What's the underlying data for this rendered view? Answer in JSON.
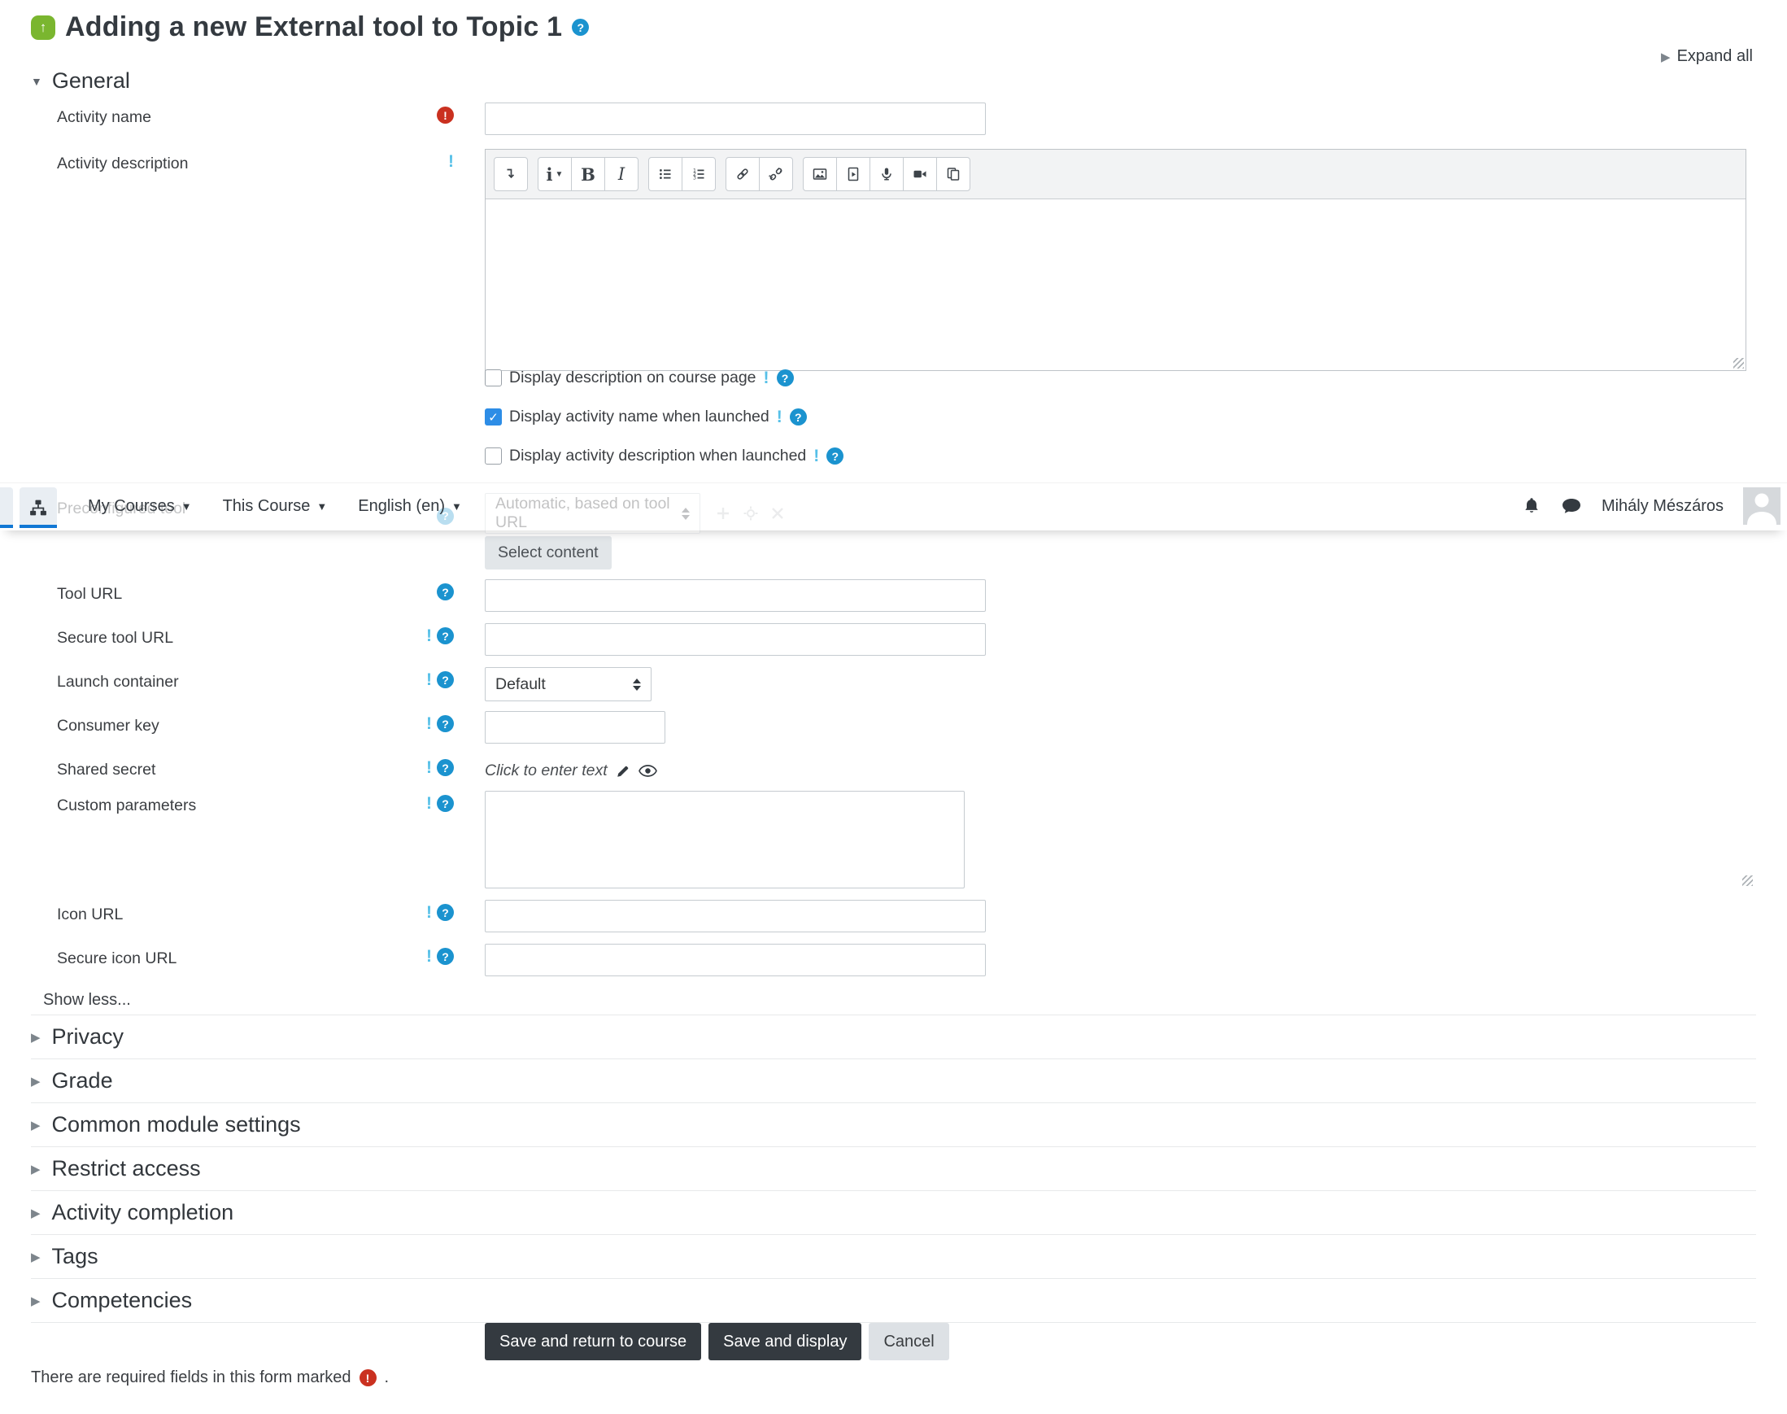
{
  "page": {
    "title": "Adding a new External tool to Topic 1",
    "expand_all": "Expand all",
    "required_note": "There are required fields in this form marked",
    "required_note_suffix": "."
  },
  "navbar": {
    "items": [
      {
        "label": "My Courses"
      },
      {
        "label": "This Course"
      },
      {
        "label": "English (en)"
      }
    ],
    "user_name": "Mihály Mészáros"
  },
  "sections": {
    "general": "General",
    "collapsed": [
      "Privacy",
      "Grade",
      "Common module settings",
      "Restrict access",
      "Activity completion",
      "Tags",
      "Competencies"
    ]
  },
  "form": {
    "activity_name": {
      "label": "Activity name",
      "value": ""
    },
    "activity_description": {
      "label": "Activity description",
      "value": ""
    },
    "checkboxes": [
      {
        "label": "Display description on course page",
        "checked": false
      },
      {
        "label": "Display activity name when launched",
        "checked": true
      },
      {
        "label": "Display activity description when launched",
        "checked": false
      }
    ],
    "preconfigured_tool": {
      "label": "Preconfigured tool",
      "selected": "Automatic, based on tool URL"
    },
    "select_content_label": "Select content",
    "tool_url": {
      "label": "Tool URL",
      "value": ""
    },
    "secure_tool_url": {
      "label": "Secure tool URL",
      "value": ""
    },
    "launch_container": {
      "label": "Launch container",
      "selected": "Default"
    },
    "consumer_key": {
      "label": "Consumer key",
      "value": ""
    },
    "shared_secret": {
      "label": "Shared secret",
      "placeholder": "Click to enter text"
    },
    "custom_parameters": {
      "label": "Custom parameters",
      "value": ""
    },
    "icon_url": {
      "label": "Icon URL",
      "value": ""
    },
    "secure_icon_url": {
      "label": "Secure icon URL",
      "value": ""
    },
    "show_less_label": "Show less..."
  },
  "buttons": {
    "save_return": "Save and return to course",
    "save_display": "Save and display",
    "cancel": "Cancel"
  },
  "editor": {
    "glyphs": {
      "styles": "i",
      "bold": "B",
      "italic": "I"
    },
    "buttons": [
      "collapse-toolbar",
      "paragraph-styles",
      "bold",
      "italic",
      "unordered-list",
      "ordered-list",
      "link",
      "unlink",
      "insert-image",
      "insert-media",
      "record-audio",
      "record-video",
      "manage-files"
    ]
  },
  "icons": {
    "external-tool-icon": "↑ on green blob",
    "help-icon": "?",
    "info-icon": "!",
    "required-icon": "!",
    "expand-caret": "▶",
    "collapse-caret": "▼",
    "checkmark": "✓"
  },
  "colors": {
    "help_blue": "#1b93cf",
    "info_blue": "#56c0e8",
    "required_red": "#ca3120",
    "checkbox_checked": "#2d8de6",
    "dark_button": "#343a40",
    "nav_active_underline": "#1177d4",
    "tool_icon_green": "#7ab62f"
  }
}
